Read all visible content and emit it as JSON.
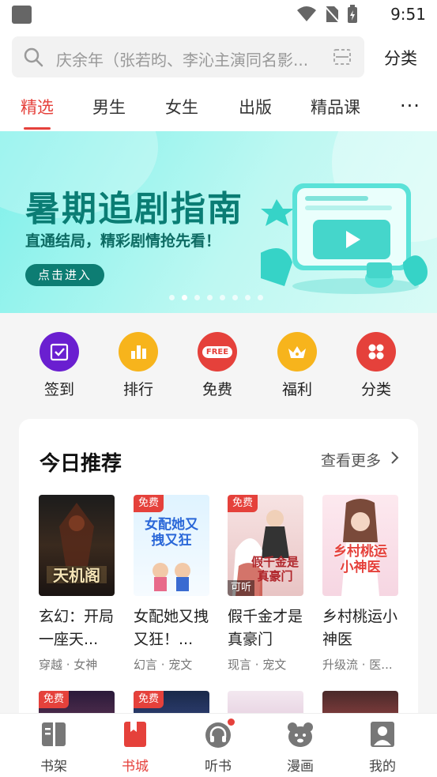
{
  "status_bar": {
    "time": "9:51"
  },
  "search": {
    "placeholder": "庆余年（张若昀、李沁主演同名影...",
    "category_label": "分类"
  },
  "tabs": [
    {
      "label": "精选",
      "active": true
    },
    {
      "label": "男生"
    },
    {
      "label": "女生"
    },
    {
      "label": "出版"
    },
    {
      "label": "精品课"
    }
  ],
  "more_tabs_label": "···",
  "banner": {
    "title": "暑期追剧指南",
    "subtitle": "直通结局，精彩剧情抢先看！",
    "button_label": "点击进入",
    "slide_count": 8,
    "active_slide": 2
  },
  "quick_entries": [
    {
      "label": "签到",
      "icon": "calendar-check-icon",
      "color": "#6a1fd0"
    },
    {
      "label": "排行",
      "icon": "bar-chart-icon",
      "color": "#f7b41c"
    },
    {
      "label": "免费",
      "icon": "free-badge-icon",
      "color": "#e5413b",
      "icon_text": "FREE"
    },
    {
      "label": "福利",
      "icon": "crown-icon",
      "color": "#f7b41c"
    },
    {
      "label": "分类",
      "icon": "grid-icon",
      "color": "#e5413b"
    }
  ],
  "recommend": {
    "title": "今日推荐",
    "more_label": "查看更多",
    "books": [
      {
        "title": "玄幻：开局一座天...",
        "tags": "穿越 · 女神",
        "free": false,
        "audio": false,
        "cover_text": "天机阁"
      },
      {
        "title": "女配她又拽又狂！...",
        "tags": "幻言 · 宠文",
        "free": true,
        "audio": false,
        "cover_text": "女配她又拽又狂"
      },
      {
        "title": "假千金才是真豪门",
        "tags": "现言 · 宠文",
        "free": true,
        "audio": true,
        "cover_text": "假千金是真豪门"
      },
      {
        "title": "乡村桃运小神医",
        "tags": "升级流 · 医...",
        "free": false,
        "audio": false,
        "cover_text": "乡村桃运小神医"
      }
    ],
    "free_label": "免费",
    "audio_label": "可听"
  },
  "bottom_nav": [
    {
      "label": "书架",
      "icon": "bookshelf-icon"
    },
    {
      "label": "书城",
      "icon": "bookstore-icon",
      "active": true
    },
    {
      "label": "听书",
      "icon": "headphones-icon",
      "dot": true
    },
    {
      "label": "漫画",
      "icon": "bear-icon"
    },
    {
      "label": "我的",
      "icon": "profile-icon"
    }
  ]
}
